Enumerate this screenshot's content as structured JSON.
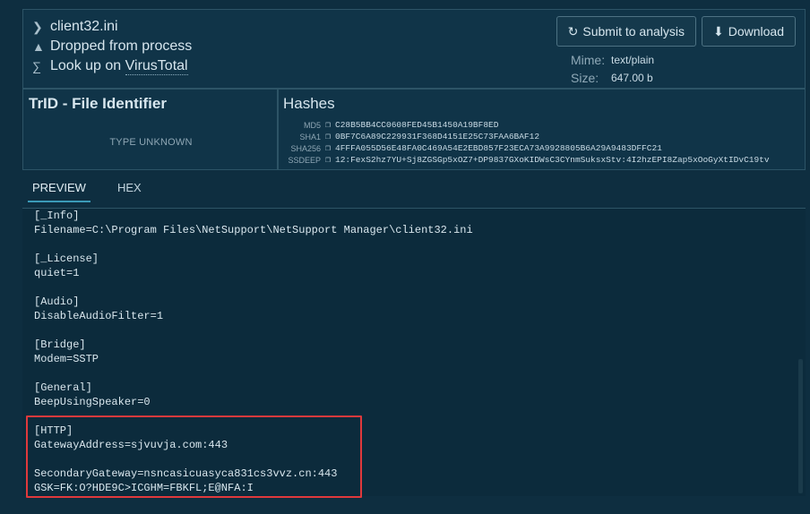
{
  "file": {
    "name": "client32.ini",
    "origin": "Dropped from process",
    "lookup_prefix": "Look up on ",
    "lookup_link": "VirusTotal"
  },
  "actions": {
    "submit_label": "Submit to analysis",
    "download_label": "Download"
  },
  "meta": {
    "mime_label": "Mime:",
    "mime_value": "text/plain",
    "size_label": "Size:",
    "size_value": "647.00 b"
  },
  "trid": {
    "title": "TrID - File Identifier",
    "status": "TYPE UNKNOWN"
  },
  "hashes": {
    "title": "Hashes",
    "items": [
      {
        "key": "MD5",
        "value": "C28B5BB4CC0608FED45B1450A19BF8ED"
      },
      {
        "key": "SHA1",
        "value": "0BF7C6A89C229931F368D4151E25C73FAA6BAF12"
      },
      {
        "key": "SHA256",
        "value": "4FFFA055D56E48FA0C469A54E2EBD857F23ECA73A9928805B6A29A9483DFFC21"
      },
      {
        "key": "SSDEEP",
        "value": "12:FexS2hz7YU+Sj8ZGSGp5xOZ7+DP9837GXoKIDWsC3CYnmSuksxStv:4I2hzEPI8Zap5xOoGyXtIDvC19tv"
      }
    ]
  },
  "tabs": [
    {
      "label": "PREVIEW",
      "active": true
    },
    {
      "label": "HEX",
      "active": false
    }
  ],
  "preview": {
    "lines": [
      "[_Info]",
      "Filename=C:\\Program Files\\NetSupport\\NetSupport Manager\\client32.ini",
      "",
      "[_License]",
      "quiet=1",
      "",
      "[Audio]",
      "DisableAudioFilter=1",
      "",
      "[Bridge]",
      "Modem=SSTP",
      "",
      "[General]",
      "BeepUsingSpeaker=0",
      "",
      "[HTTP]",
      "GatewayAddress=sjvuvja.com:443",
      "",
      "SecondaryGateway=nsncasicuasyca831cs3vvz.cn:443",
      "GSK=FK:O?HDE9C>ICGHM=FBKFL;E@NFA:I"
    ]
  },
  "colors": {
    "background": "#0e2e40",
    "panel": "#103448",
    "accent": "#3b9ab7",
    "highlight": "#e0393c"
  }
}
